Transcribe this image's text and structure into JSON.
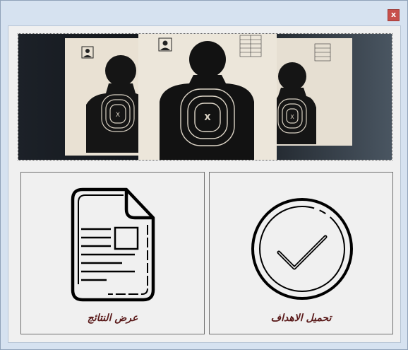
{
  "window": {
    "close_label": "x"
  },
  "banner": {
    "image": "shooting-targets-photo",
    "target_mark": "X"
  },
  "panels": {
    "results": {
      "label": "عرض النتائج",
      "icon": "document-icon"
    },
    "load_targets": {
      "label": "تحميل الاهداف",
      "icon": "checkmark-circle-icon"
    }
  }
}
